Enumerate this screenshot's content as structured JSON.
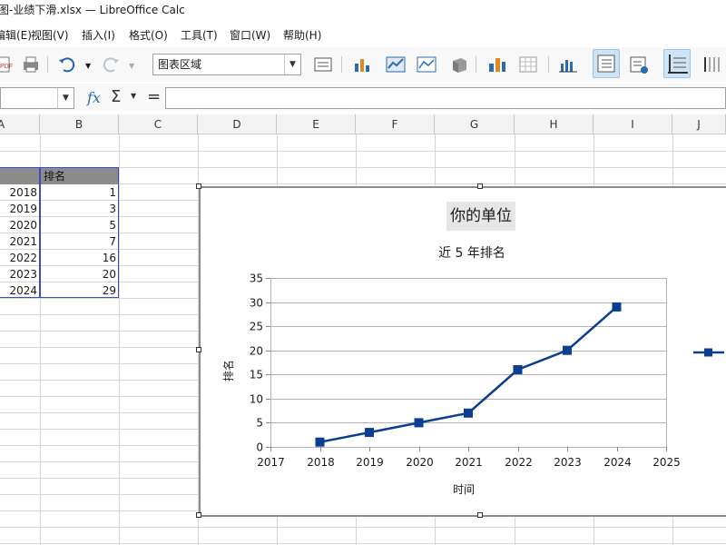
{
  "window": {
    "title": "线图-业绩下滑.xlsx — LibreOffice Calc"
  },
  "menu": [
    "编辑(E)",
    "视图(V)",
    "插入(I)",
    "格式(O)",
    "工具(T)",
    "窗口(W)",
    "帮助(H)"
  ],
  "toolbar": {
    "chart_element_select": "图表区域",
    "icons": [
      "export-pdf-icon",
      "print-icon",
      "undo-icon",
      "redo-icon",
      "format-selection-icon",
      "chart-type-icon",
      "chart-data-range-icon",
      "data-table-icon",
      "3d-view-icon",
      "chart-wall-icon",
      "chart-area-icon",
      "horizontal-grid-icon",
      "legend-toggle-icon",
      "legend-icon",
      "text-scaling-icon",
      "axis-icon"
    ]
  },
  "formula_bar": {
    "name_box_value": "",
    "fx_label": "fx",
    "sum_label": "Σ",
    "equals_label": "=",
    "formula_value": ""
  },
  "columns": [
    "A",
    "B",
    "C",
    "D",
    "E",
    "F",
    "G",
    "H",
    "I",
    "J"
  ],
  "sheet": {
    "header_b": "排名",
    "rows": [
      {
        "year": "2018",
        "rank": "1"
      },
      {
        "year": "2019",
        "rank": "3"
      },
      {
        "year": "2020",
        "rank": "5"
      },
      {
        "year": "2021",
        "rank": "7"
      },
      {
        "year": "2022",
        "rank": "16"
      },
      {
        "year": "2023",
        "rank": "20"
      },
      {
        "year": "2024",
        "rank": "29"
      }
    ]
  },
  "colors": {
    "series": "#0b3d91",
    "grid": "#b3b3b3",
    "selection": "#3b4cc0",
    "header_fill": "#8c8c8c",
    "toolbar_active": "#cfe3f6"
  },
  "chart_data": {
    "type": "line",
    "main_title": "你的单位",
    "subtitle": "近 5 年排名",
    "xlabel": "时间",
    "ylabel": "排名",
    "xlim": [
      2017,
      2025
    ],
    "ylim": [
      0,
      35
    ],
    "x_ticks": [
      "2017",
      "2018",
      "2019",
      "2020",
      "2021",
      "2022",
      "2023",
      "2024",
      "2025"
    ],
    "y_ticks": [
      "0",
      "5",
      "10",
      "15",
      "20",
      "25",
      "30",
      "35"
    ],
    "grid": "horizontal",
    "legend_position": "right",
    "marker": "square",
    "series": [
      {
        "x": [
          2018,
          2019,
          2020,
          2021,
          2022,
          2023,
          2024
        ],
        "values": [
          1,
          3,
          5,
          7,
          16,
          20,
          29
        ]
      }
    ]
  }
}
